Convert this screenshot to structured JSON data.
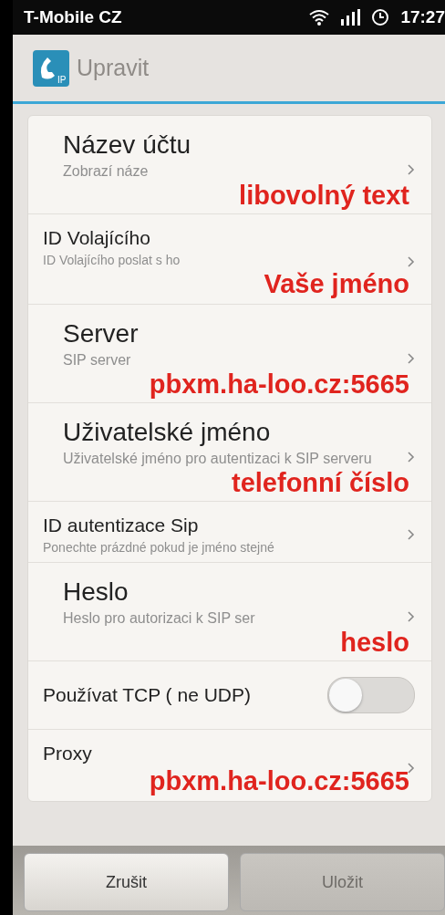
{
  "status_bar": {
    "carrier": "T-Mobile CZ",
    "time": "17:27"
  },
  "title_bar": {
    "app_icon_label": "IP",
    "title": "Upravit"
  },
  "settings": [
    {
      "kind": "large",
      "title": "Název účtu",
      "subtitle": "Zobrazí náze",
      "annotation": "libovolný text"
    },
    {
      "kind": "small",
      "title": "ID Volajícího",
      "subtitle": "ID Volajícího poslat s ho",
      "annotation": "Vaše jméno"
    },
    {
      "kind": "large",
      "title": "Server",
      "subtitle": "SIP server",
      "annotation": "pbxm.ha-loo.cz:5665"
    },
    {
      "kind": "large",
      "title": "Uživatelské jméno",
      "subtitle": "Uživatelské jméno pro autentizaci k SIP serveru",
      "annotation": "telefonní číslo"
    },
    {
      "kind": "small",
      "title": "ID autentizace Sip",
      "subtitle": "Ponechte prázdné pokud je jméno stejné"
    },
    {
      "kind": "large",
      "title": "Heslo",
      "subtitle": "Heslo pro autorizaci k SIP ser",
      "annotation": "heslo"
    },
    {
      "kind": "toggle",
      "title": "Používat TCP ( ne UDP)",
      "on": false
    },
    {
      "kind": "small",
      "title": "Proxy",
      "annotation": "pbxm.ha-loo.cz:5665"
    }
  ],
  "buttons": [
    {
      "label": "Zrušit",
      "disabled": false
    },
    {
      "label": "Uložit",
      "disabled": true
    }
  ]
}
